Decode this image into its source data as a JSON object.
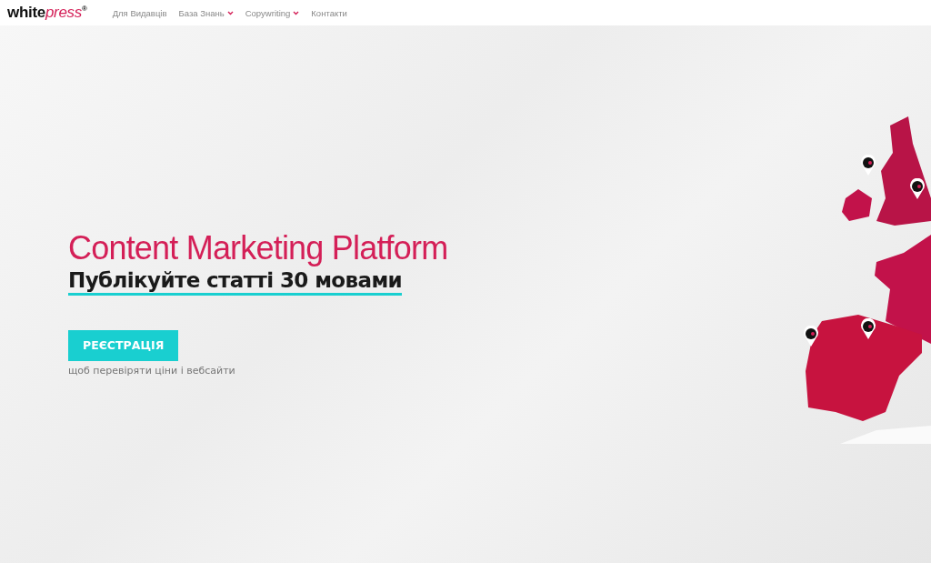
{
  "header": {
    "logo": {
      "word": "white",
      "accent": "press",
      "mark": "®"
    },
    "nav": [
      {
        "label": "Для Видавців",
        "dropdown": false
      },
      {
        "label": "База Знань",
        "dropdown": true
      },
      {
        "label": "Copywriting",
        "dropdown": true
      },
      {
        "label": "Контакти",
        "dropdown": false
      }
    ]
  },
  "hero": {
    "title": "Content Marketing Platform",
    "subtitle": "Публікуйте статті 30 мовами",
    "button": "РЕЄСТРАЦІЯ",
    "note": "щоб перевіряти ціни і вебсайти"
  }
}
